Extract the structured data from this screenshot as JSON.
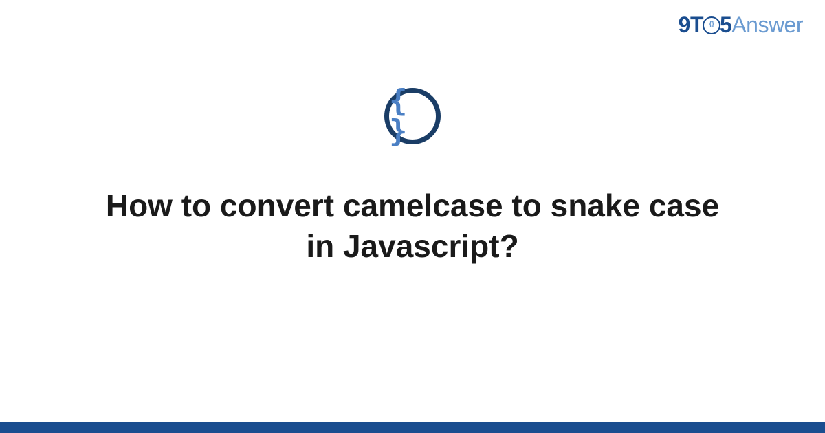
{
  "brand": {
    "part1": "9T",
    "clock_inner": "{}",
    "part2": "5",
    "part3": "Answer"
  },
  "icon": {
    "glyph": "{ }",
    "name": "code-braces-icon"
  },
  "page": {
    "title": "How to convert camelcase to snake case in Javascript?"
  },
  "colors": {
    "primary": "#1a4d8f",
    "accent": "#6b9bd1",
    "dark_ring": "#1a3d66",
    "brace_blue": "#4a7fc4"
  }
}
